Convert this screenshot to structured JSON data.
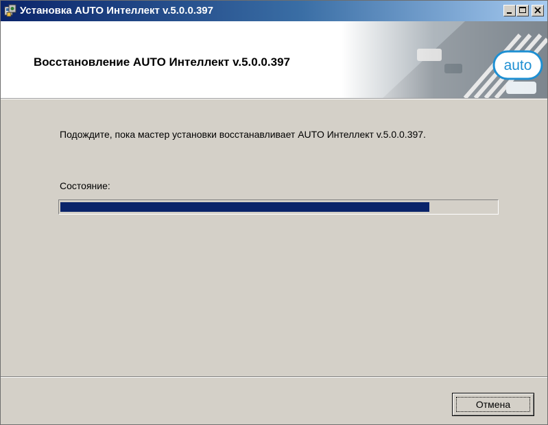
{
  "window": {
    "title": "Установка AUTO Интеллект v.5.0.0.397",
    "icon": "installer-icon",
    "controls": [
      "minimize-icon",
      "maximize-icon",
      "close-icon"
    ]
  },
  "header": {
    "title": "Восстановление AUTO Интеллект v.5.0.0.397",
    "logo_text": "auto"
  },
  "main": {
    "message": "Подождите, пока мастер установки восстанавливает AUTO Интеллект v.5.0.0.397.",
    "status_label": "Состояние:",
    "progress_percent": 84.6
  },
  "footer": {
    "cancel_label": "Отмена"
  },
  "colors": {
    "accent": "#0a246a",
    "window_bg": "#d4d0c8",
    "logo_blue": "#1e8fd2"
  }
}
